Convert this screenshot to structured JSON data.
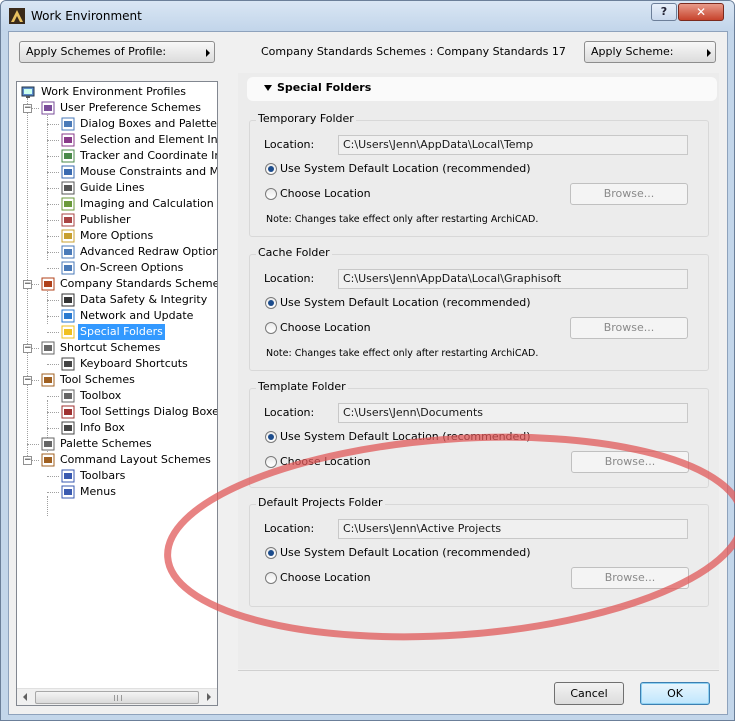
{
  "window": {
    "title": "Work Environment",
    "help_label": "?",
    "close_label": "✕"
  },
  "toolbar": {
    "apply_profile_label": "Apply Schemes of Profile:",
    "scheme_info": "Company Standards Schemes : Company Standards 17",
    "apply_scheme_label": "Apply Scheme:"
  },
  "tree": {
    "root": "Work Environment Profiles",
    "items": [
      {
        "label": "User Preference Schemes",
        "icon": "user-preference-icon"
      },
      {
        "label": "Dialog Boxes and Palettes",
        "icon": "dialog-boxes-icon"
      },
      {
        "label": "Selection and Element Inforr",
        "icon": "selection-info-icon"
      },
      {
        "label": "Tracker and Coordinate Inpu",
        "icon": "tracker-icon"
      },
      {
        "label": "Mouse Constraints and Meth",
        "icon": "mouse-icon"
      },
      {
        "label": "Guide Lines",
        "icon": "guide-lines-icon"
      },
      {
        "label": "Imaging and Calculation",
        "icon": "imaging-icon"
      },
      {
        "label": "Publisher",
        "icon": "publisher-icon"
      },
      {
        "label": "More Options",
        "icon": "more-options-icon"
      },
      {
        "label": "Advanced Redraw Options",
        "icon": "redraw-icon"
      },
      {
        "label": "On-Screen Options",
        "icon": "on-screen-icon"
      },
      {
        "label": "Company Standards Schemes",
        "icon": "company-standards-icon"
      },
      {
        "label": "Data Safety & Integrity",
        "icon": "data-safety-icon"
      },
      {
        "label": "Network and Update",
        "icon": "network-globe-icon"
      },
      {
        "label": "Special Folders",
        "icon": "folder-icon"
      },
      {
        "label": "Shortcut Schemes",
        "icon": "shortcut-schemes-icon"
      },
      {
        "label": "Keyboard Shortcuts",
        "icon": "keyboard-shortcuts-icon"
      },
      {
        "label": "Tool Schemes",
        "icon": "tool-schemes-icon"
      },
      {
        "label": "Toolbox",
        "icon": "toolbox-icon"
      },
      {
        "label": "Tool Settings Dialog Boxes",
        "icon": "tool-settings-icon"
      },
      {
        "label": "Info Box",
        "icon": "info-box-icon"
      },
      {
        "label": "Palette Schemes",
        "icon": "palette-schemes-icon"
      },
      {
        "label": "Command Layout Schemes",
        "icon": "command-layout-icon"
      },
      {
        "label": "Toolbars",
        "icon": "toolbars-icon"
      },
      {
        "label": "Menus",
        "icon": "menus-icon"
      }
    ],
    "selected": "Special Folders"
  },
  "panel": {
    "section_title": "Special Folders",
    "location_label": "Location:",
    "use_default_label": "Use System Default Location (recommended)",
    "choose_label": "Choose Location",
    "browse_label": "Browse...",
    "note": "Note: Changes take effect only after restarting ArchiCAD.",
    "groups": [
      {
        "title": "Temporary Folder",
        "location": "C:\\Users\\Jenn\\AppData\\Local\\Temp"
      },
      {
        "title": "Cache Folder",
        "location": "C:\\Users\\Jenn\\AppData\\Local\\Graphisoft"
      },
      {
        "title": "Template Folder",
        "location": "C:\\Users\\Jenn\\Documents"
      },
      {
        "title": "Default Projects Folder",
        "location": "C:\\Users\\Jenn\\Active Projects"
      }
    ]
  },
  "buttons": {
    "cancel": "Cancel",
    "ok": "OK"
  },
  "colors": {
    "selection": "#3399ff",
    "annotation_ellipse": "#e05a5a"
  }
}
